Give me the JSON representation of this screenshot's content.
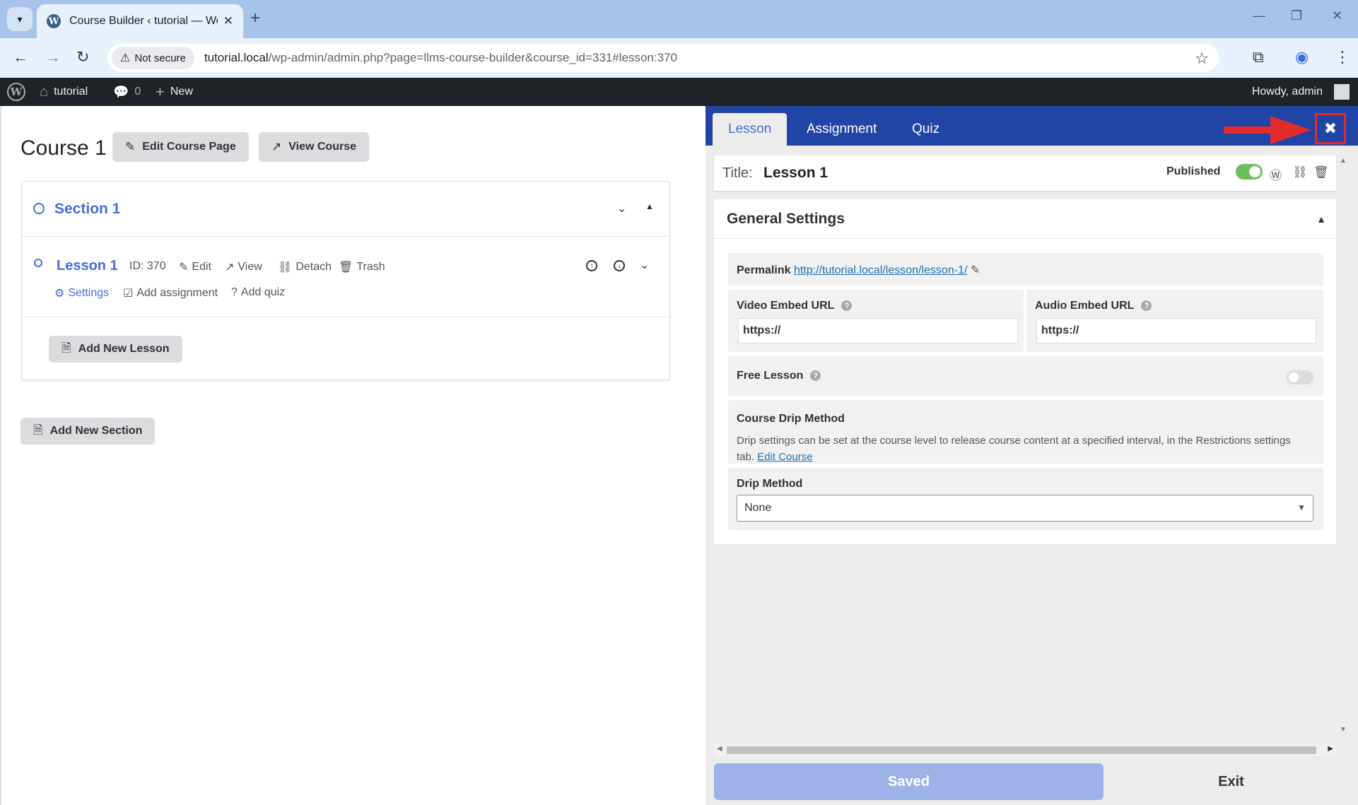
{
  "browser": {
    "tab_title": "Course Builder ‹ tutorial — Wor",
    "not_secure": "Not secure",
    "url_host": "tutorial.local",
    "url_path": "/wp-admin/admin.php?page=llms-course-builder&course_id=331#lesson:370"
  },
  "adminbar": {
    "site": "tutorial",
    "comments": "0",
    "new": "New",
    "howdy": "Howdy, admin"
  },
  "course": {
    "title": "Course 1",
    "edit_page": "Edit Course Page",
    "view_course": "View Course",
    "section": {
      "title": "Section 1",
      "lesson": {
        "title": "Lesson 1",
        "id": "ID: 370",
        "edit": "Edit",
        "view": "View",
        "detach": "Detach",
        "trash": "Trash",
        "settings": "Settings",
        "add_assignment": "Add assignment",
        "add_quiz": "Add quiz"
      },
      "add_lesson": "Add New Lesson"
    },
    "add_section": "Add New Section"
  },
  "sidebar": {
    "tabs": [
      "Lesson",
      "Assignment",
      "Quiz"
    ],
    "title_label": "Title:",
    "title_value": "Lesson 1",
    "published": "Published",
    "general_settings": "General Settings",
    "permalink_label": "Permalink",
    "permalink_url": "http://tutorial.local/lesson/lesson-1/",
    "video_label": "Video Embed URL",
    "video_value": "https://",
    "audio_label": "Audio Embed URL",
    "audio_value": "https://",
    "free_lesson": "Free Lesson",
    "drip_heading": "Course Drip Method",
    "drip_desc": "Drip settings can be set at the course level to release course content at a specified interval, in the Restrictions settings tab.",
    "edit_course_link": "Edit Course",
    "drip_method_label": "Drip Method",
    "drip_method_value": "None",
    "saved": "Saved",
    "exit": "Exit"
  },
  "colors": {
    "accent": "#466dd8",
    "sidebar_header": "#2145a6",
    "annotation": "#e32b2b"
  }
}
